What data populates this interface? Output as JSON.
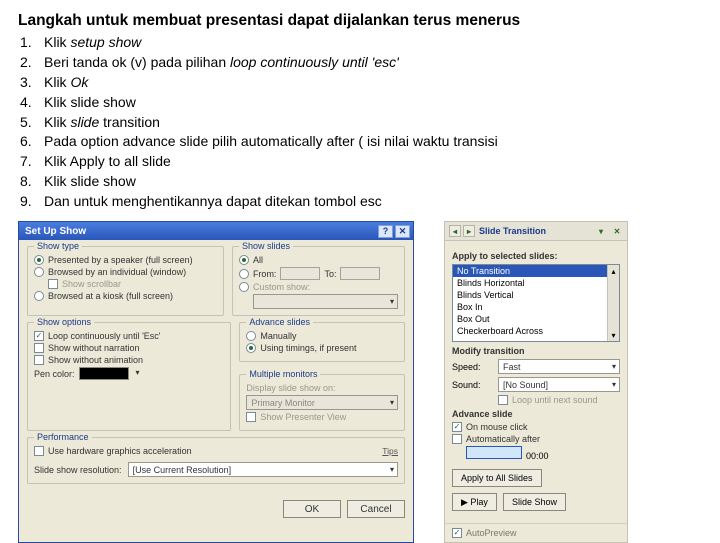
{
  "title": "Langkah untuk membuat presentasi dapat dijalankan terus menerus",
  "steps": [
    {
      "n": "1.",
      "t": "Klik ",
      "it": "setup show"
    },
    {
      "n": "2.",
      "t": "Beri tanda ok (v) pada pilihan  ",
      "it": "loop continuously until 'esc'"
    },
    {
      "n": "3.",
      "t": "Klik  ",
      "it": "Ok"
    },
    {
      "n": "4.",
      "t": "Klik   slide show"
    },
    {
      "n": "5.",
      "t": "Klik ",
      "it": "slide",
      " tail": " transition"
    },
    {
      "n": "6.",
      "t": "Pada option advance slide  pilih automatically after ( isi  nilai waktu transisi"
    },
    {
      "n": "7.",
      "t": "Klik Apply to all slide"
    },
    {
      "n": "8.",
      "t": "Klik slide show"
    },
    {
      "n": "9.",
      "t": "Dan untuk menghentikannya  dapat ditekan  tombol  esc"
    }
  ],
  "dlg": {
    "title": "Set Up Show",
    "help": "?",
    "close": "✕",
    "grp_showtype": "Show type",
    "st_presented": "Presented by a speaker (full screen)",
    "st_individual": "Browsed by an individual (window)",
    "st_scrollbar": "Show scrollbar",
    "st_kiosk": "Browsed at a kiosk (full screen)",
    "grp_showslides": "Show slides",
    "ss_all": "All",
    "ss_from": "From:",
    "ss_to": "To:",
    "ss_custom": "Custom show:",
    "grp_showoptions": "Show options",
    "so_loop": "Loop continuously until 'Esc'",
    "so_nonarr": "Show without narration",
    "so_noanim": "Show without animation",
    "so_pen": "Pen color:",
    "grp_advance": "Advance slides",
    "adv_manual": "Manually",
    "adv_timings": "Using timings, if present",
    "grp_mm": "Multiple monitors",
    "mm_display": "Display slide show on:",
    "mm_primary": "Primary Monitor",
    "mm_presenter": "Show Presenter View",
    "grp_perf": "Performance",
    "perf_hw": "Use hardware graphics acceleration",
    "perf_tips": "Tips",
    "perf_res": "Slide show resolution:",
    "perf_resval": "[Use Current Resolution]",
    "ok": "OK",
    "cancel": "Cancel"
  },
  "pane": {
    "title": "Slide Transition",
    "apply_label": "Apply to selected slides:",
    "items": [
      "No Transition",
      "Blinds Horizontal",
      "Blinds Vertical",
      "Box In",
      "Box Out",
      "Checkerboard Across"
    ],
    "modify": "Modify transition",
    "speed_l": "Speed:",
    "speed_v": "Fast",
    "sound_l": "Sound:",
    "sound_v": "[No Sound]",
    "loop_snd": "Loop until next sound",
    "advance": "Advance slide",
    "on_click": "On mouse click",
    "auto_after": "Automatically after",
    "auto_val": "00:00",
    "apply_all": "Apply to All Slides",
    "play": "▶ Play",
    "show": "Slide Show",
    "autoprev": "AutoPreview"
  }
}
